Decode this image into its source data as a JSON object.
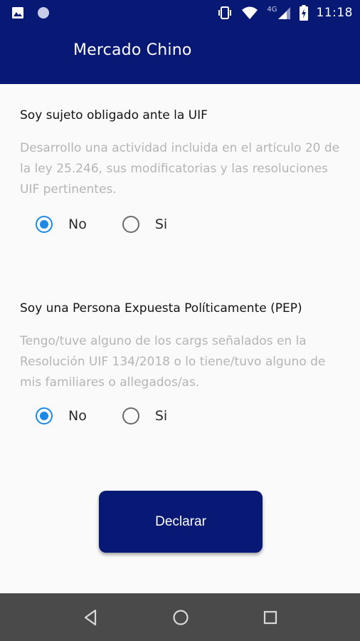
{
  "status_bar": {
    "time": "11:18",
    "network": "4G",
    "icons": [
      "image-icon",
      "circle-notification-icon",
      "vibrate-icon",
      "wifi-icon",
      "signal-icon",
      "battery-charging-icon"
    ]
  },
  "app_bar": {
    "title": "Mercado Chino"
  },
  "uif_section": {
    "title": "Soy sujeto obligado ante la UIF",
    "description": "Desarrollo una actividad incluida en el artículo 20 de la ley 25.246, sus modificatorias y las resoluciones UIF pertinentes.",
    "options": [
      {
        "label": "No",
        "selected": true
      },
      {
        "label": "Si",
        "selected": false
      }
    ]
  },
  "pep_section": {
    "title": "Soy una Persona Expuesta Políticamente (PEP)",
    "description": "Tengo/tuve alguno de los cargs señalados en la Resolución UIF 134/2018 o lo tiene/tuvo alguno de mis familiares o allegados/as.",
    "options": [
      {
        "label": "No",
        "selected": true
      },
      {
        "label": "Si",
        "selected": false
      }
    ]
  },
  "submit_button": {
    "label": "Declarar"
  },
  "colors": {
    "primary": "#071875",
    "radio_selected": "#1e88e5",
    "description_text": "#b5b5b5",
    "navbar": "#4a4a4a"
  },
  "nav_bar": {
    "buttons": [
      "back-icon",
      "home-icon",
      "recents-icon"
    ]
  }
}
